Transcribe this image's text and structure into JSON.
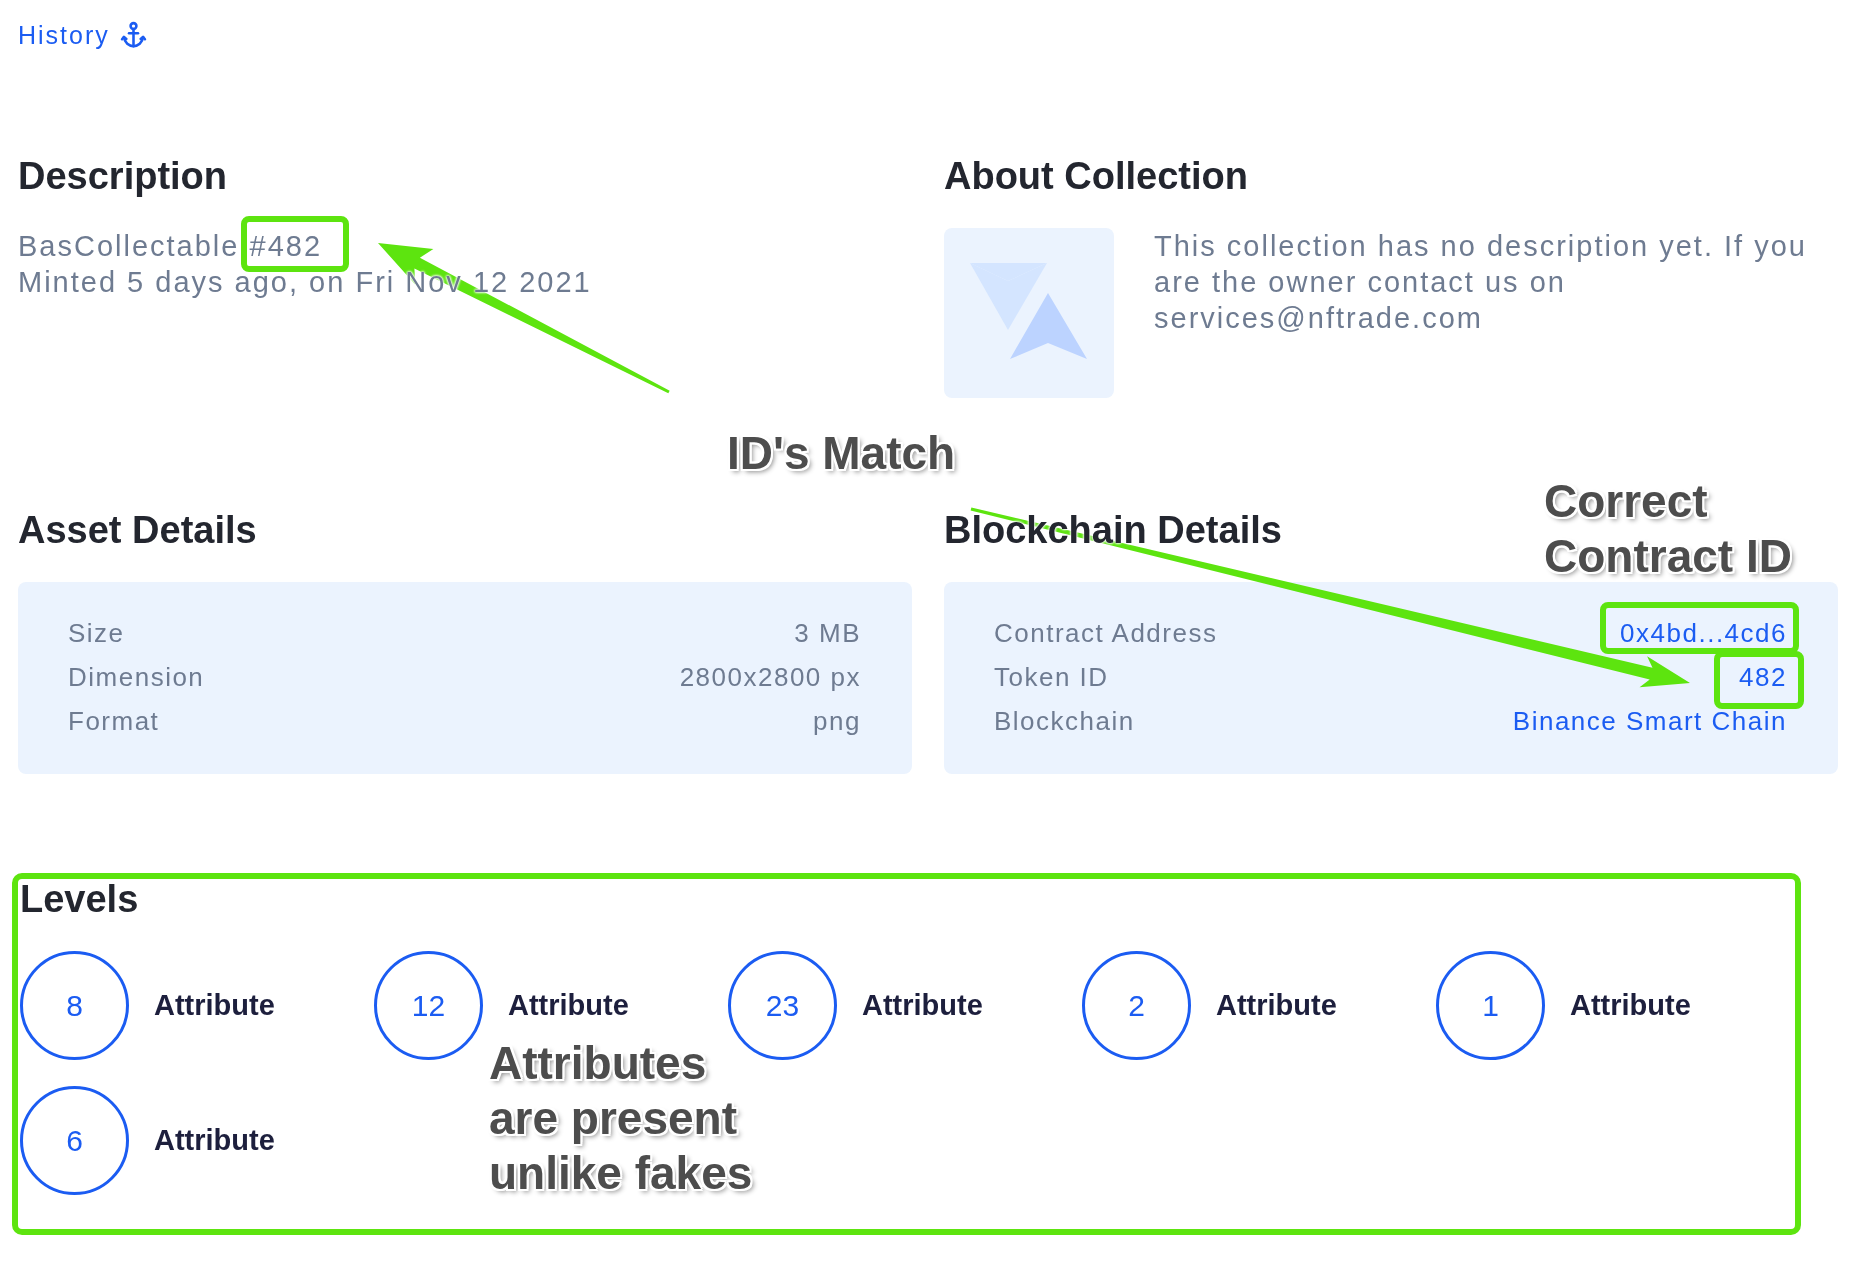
{
  "history_link": {
    "label": "History"
  },
  "description": {
    "title": "Description",
    "name": "BasCollectable #482",
    "minted": "Minted 5 days ago, on Fri Nov 12 2021"
  },
  "about_collection": {
    "title": "About Collection",
    "text": "This collection has no description yet. If you are the owner contact us on services@nftrade.com"
  },
  "asset_details": {
    "title": "Asset Details",
    "rows": [
      {
        "label": "Size",
        "value": "3 MB",
        "kind": "text"
      },
      {
        "label": "Dimension",
        "value": "2800x2800 px",
        "kind": "text"
      },
      {
        "label": "Format",
        "value": "png",
        "kind": "text"
      }
    ]
  },
  "blockchain_details": {
    "title": "Blockchain Details",
    "rows": [
      {
        "label": "Contract Address",
        "value": "0x4bd...4cd6",
        "kind": "link"
      },
      {
        "label": "Token ID",
        "value": "482",
        "kind": "link"
      },
      {
        "label": "Blockchain",
        "value": "Binance Smart Chain",
        "kind": "link"
      }
    ]
  },
  "levels": {
    "title": "Levels",
    "items": [
      {
        "value": "8",
        "label": "Attribute"
      },
      {
        "value": "12",
        "label": "Attribute"
      },
      {
        "value": "23",
        "label": "Attribute"
      },
      {
        "value": "2",
        "label": "Attribute"
      },
      {
        "value": "1",
        "label": "Attribute"
      },
      {
        "value": "6",
        "label": "Attribute"
      }
    ]
  },
  "annotations": [
    {
      "text": "ID's Match"
    },
    {
      "text": "Correct Contract ID"
    },
    {
      "text": "Attributes are present unlike fakes"
    }
  ]
}
